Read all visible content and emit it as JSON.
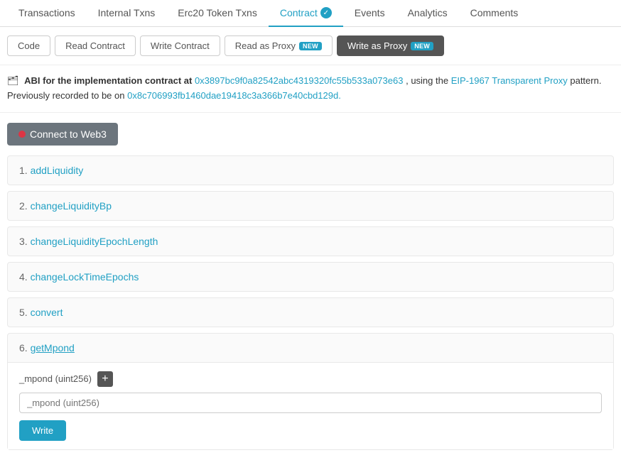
{
  "nav": {
    "tabs": [
      {
        "id": "transactions",
        "label": "Transactions",
        "active": false
      },
      {
        "id": "internal-txns",
        "label": "Internal Txns",
        "active": false
      },
      {
        "id": "erc20-token-txns",
        "label": "Erc20 Token Txns",
        "active": false
      },
      {
        "id": "contract",
        "label": "Contract",
        "active": true,
        "verified": true
      },
      {
        "id": "events",
        "label": "Events",
        "active": false
      },
      {
        "id": "analytics",
        "label": "Analytics",
        "active": false
      },
      {
        "id": "comments",
        "label": "Comments",
        "active": false
      }
    ]
  },
  "sub_buttons": [
    {
      "id": "code",
      "label": "Code",
      "active": false,
      "has_new": false
    },
    {
      "id": "read-contract",
      "label": "Read Contract",
      "active": false,
      "has_new": false
    },
    {
      "id": "write-contract",
      "label": "Write Contract",
      "active": false,
      "has_new": false
    },
    {
      "id": "read-as-proxy",
      "label": "Read as Proxy",
      "active": false,
      "has_new": true
    },
    {
      "id": "write-as-proxy",
      "label": "Write as Proxy",
      "active": true,
      "has_new": true
    }
  ],
  "info": {
    "prefix_text": "ABI for the implementation contract at ",
    "impl_address": "0x3897bc9f0a82542abc4319320fc55b533a073e63",
    "using_text": ", using the ",
    "eip_link_text": "EIP-1967 Transparent Proxy",
    "pattern_text": " pattern.",
    "prev_text": "Previously recorded to be on ",
    "prev_address": "0x8c706993fb1460dae19418c3a366b7e40cbd129d."
  },
  "connect_btn": {
    "label": "Connect to Web3"
  },
  "functions": [
    {
      "number": "1.",
      "name": "addLiquidity",
      "expanded": false
    },
    {
      "number": "2.",
      "name": "changeLiquidityBp",
      "expanded": false
    },
    {
      "number": "3.",
      "name": "changeLiquidityEpochLength",
      "expanded": false
    },
    {
      "number": "4.",
      "name": "changeLockTimeEpochs",
      "expanded": false
    },
    {
      "number": "5.",
      "name": "convert",
      "expanded": false
    },
    {
      "number": "6.",
      "name": "getMpond",
      "expanded": true
    }
  ],
  "expanded_function": {
    "param_label": "_mpond (uint256)",
    "input_placeholder": "_mpond (uint256)",
    "write_btn_label": "Write",
    "new_badge_text": "NEW"
  },
  "badges": {
    "new_text": "NEW"
  }
}
